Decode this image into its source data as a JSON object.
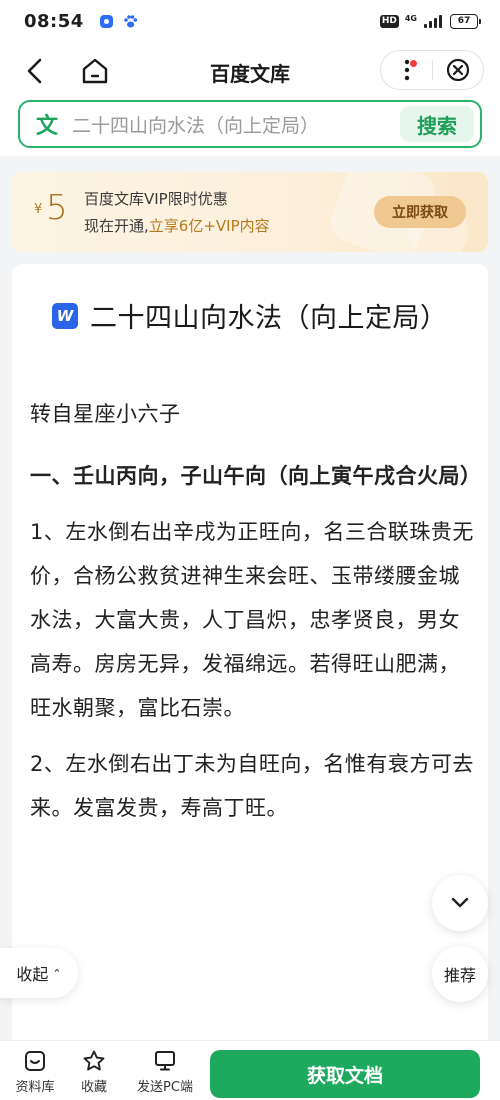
{
  "status_bar": {
    "time": "08:54",
    "hd": "HD",
    "network": "4G",
    "battery": "67",
    "icons": [
      "baidu-app-icon",
      "paw-icon",
      "signal-icon",
      "battery-icon"
    ]
  },
  "nav": {
    "title": "百度文库",
    "icons": [
      "back-arrow-icon",
      "home-icon",
      "more-dots-icon",
      "close-circle-icon"
    ]
  },
  "search": {
    "logo": "文",
    "query": "二十四山向水法（向上定局）",
    "button_label": "搜索"
  },
  "promo": {
    "currency": "¥",
    "amount": "5",
    "line1": "百度文库VIP限时优惠",
    "line2_prefix": "现在开通,",
    "line2_highlight": "立享6亿+VIP内容",
    "button_label": "立即获取"
  },
  "document": {
    "icon_letter": "W",
    "title": "二十四山向水法（向上定局）",
    "source": "转自星座小六子",
    "heading1": "一、壬山丙向，子山午向（向上寅午戌合火局）",
    "para1": "1、左水倒右出辛戌为正旺向，名三合联珠贵无价，合杨公救贫进神生来会旺、玉带缕腰金城水法，大富大贵，人丁昌炽，忠孝贤良，男女高寿。房房无异，发福绵远。若得旺山肥满，旺水朝聚，富比石崇。",
    "para2": "2、左水倒右出丁未为自旺向，名惟有衰方可去来。发富发贵，寿高丁旺。"
  },
  "floating": {
    "collapse_label": "收起",
    "collapse_caret": "⌃",
    "recommend_label": "推荐"
  },
  "bottom_bar": {
    "library_label": "资料库",
    "favorite_label": "收藏",
    "send_pc_label": "发送PC端",
    "get_doc_label": "获取文档"
  },
  "colors": {
    "accent_green": "#1eaa5e",
    "search_border": "#2bb26a",
    "promo_gold": "#b7791f",
    "word_blue": "#2a65e8",
    "notification_red": "#f23c3c"
  }
}
